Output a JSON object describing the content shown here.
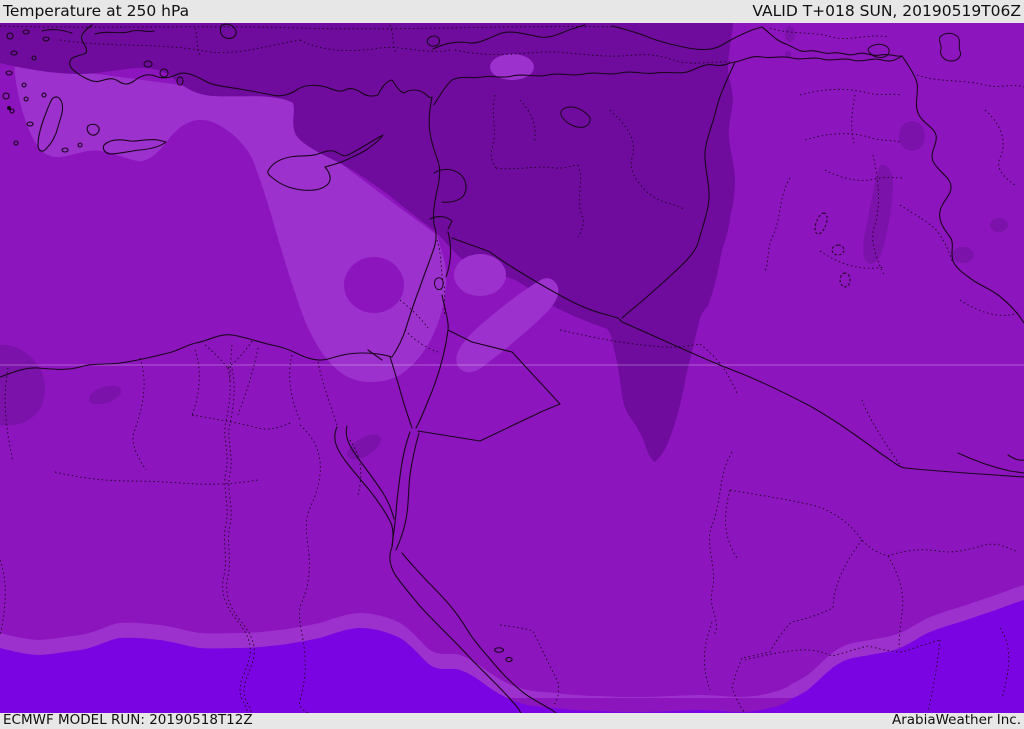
{
  "header": {
    "title": "Temperature at 250 hPa",
    "valid_label": "VALID T+018 SUN, 20190519T06Z"
  },
  "footer": {
    "model_run_label": "ECMWF MODEL RUN: 20190518T12Z",
    "credit": "ArabiaWeather Inc."
  },
  "palette": {
    "bar_bg": "#e7e7e7",
    "bar_text": "#111111",
    "base": "#8d15bd",
    "light": "#9c31cd",
    "dark": "#6f0c9e",
    "blob": "#7b12aa",
    "violet": "#7a04e2",
    "line": "#1a051d",
    "graticule": "rgba(255,255,255,0.32)"
  },
  "map": {
    "parameter": "Temperature",
    "level": "250 hPa",
    "model": "ECMWF",
    "area": "Eastern Mediterranean / Middle East",
    "shading_regions": [
      {
        "name": "cold-upper-region-north",
        "shade": "dark"
      },
      {
        "name": "cold-lobe-syria-jordan",
        "shade": "dark"
      },
      {
        "name": "mild-lobe-aegean-levant",
        "shade": "light"
      },
      {
        "name": "warm-band-south",
        "shade": "violet"
      },
      {
        "name": "background-field",
        "shade": "base"
      }
    ]
  }
}
